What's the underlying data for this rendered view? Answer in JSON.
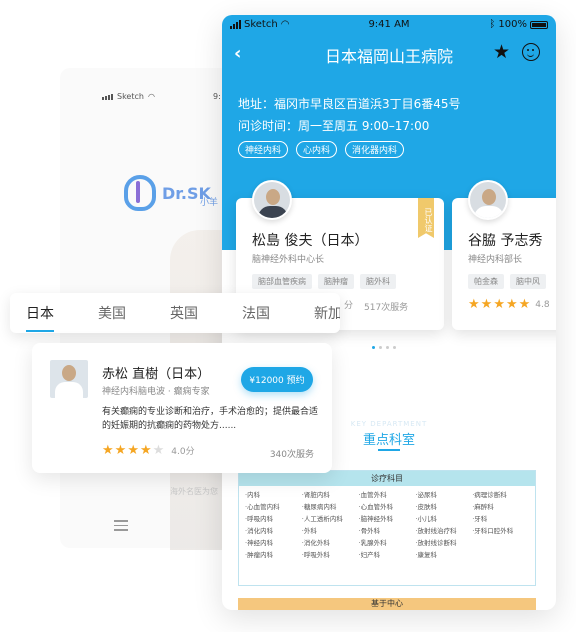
{
  "back_screen": {
    "status_carrier": "Sketch",
    "status_time": "9:",
    "logo_text": "Dr.SK",
    "logo_sub": "小羊",
    "footer_text": "海外名医为您"
  },
  "country_tabs": [
    "日本",
    "美国",
    "英国",
    "法国",
    "新加"
  ],
  "doctor_card": {
    "name": "赤松 直樹（日本）",
    "title": "神经内科脑电波 · 癫痫专家",
    "price_button": "¥12000 预约",
    "description": "有关癫痫的专业诊断和治疗，手术治愈的；提供最合适的妊娠期的抗癫痫的药物处方......",
    "rating": "4.0分",
    "stars": 4,
    "service_count": "340次服务"
  },
  "phone": {
    "status": {
      "carrier": "Sketch",
      "time": "9:41 AM",
      "battery": "100%"
    },
    "title": "日本福岡山王病院",
    "address": "地址：福冈市早良区百道浜3丁目6番45号",
    "hours": "问诊时间：周一至周五 9:00–17:00",
    "departments": [
      "神经内科",
      "心内科",
      "消化器内科"
    ],
    "doctors": [
      {
        "name": "松島 俊夫（日本）",
        "title": "脑神经外科中心长",
        "badge": "已认证",
        "tags": [
          "脑部血管疾病",
          "脑肿瘤",
          "脑外科"
        ],
        "rating": "分",
        "service_count": "517次服务"
      },
      {
        "name": "谷脇 予志秀",
        "title": "神经内科部长",
        "tags": [
          "帕金森",
          "脑中风"
        ],
        "rating": "4.8",
        "stars": 5
      }
    ],
    "section_ghost": "KEY DEPARTMENT",
    "section_title": "重点科室",
    "table_head": "诊疗科目",
    "table_items": [
      "·内科",
      "·肾脏内科",
      "·血管外科",
      "·泌尿科",
      "·病理诊断科",
      "·心血管内科",
      "·糖尿病内科",
      "·心血管外科",
      "·皮肤科",
      "·麻醉科",
      "·呼吸内科",
      "·人工透析内科",
      "·脑神经外科",
      "·小儿科",
      "·牙科",
      "·消化内科",
      "·外科",
      "·骨外科",
      "·放射线治疗科",
      "·牙科口腔外科",
      "·神经内科",
      "·消化外科",
      "·乳腺外科",
      "·放射线诊断科",
      "",
      "·肿瘤内科",
      "·呼吸外科",
      "·妇产科",
      "·康复科",
      ""
    ],
    "footer_bar": "基于中心"
  },
  "colors": {
    "primary": "#1fa7e6",
    "star": "#f5a623",
    "ribbon": "#f0c96b"
  }
}
